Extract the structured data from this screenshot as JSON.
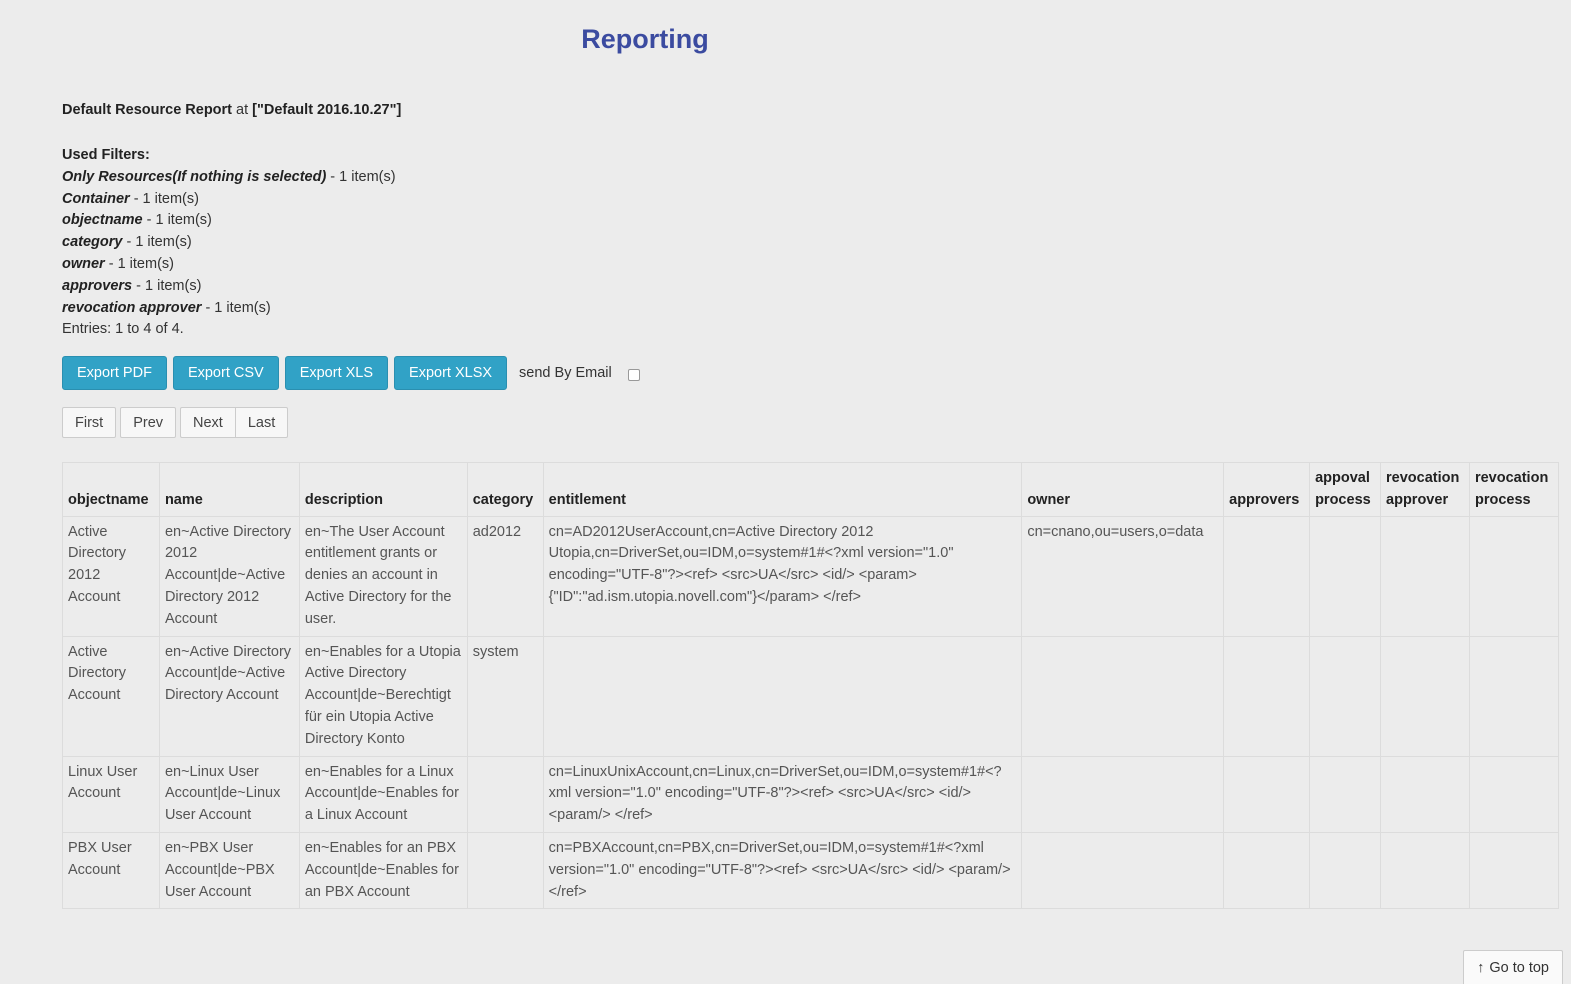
{
  "page": {
    "title": "Reporting"
  },
  "report": {
    "name": "Default Resource Report",
    "at_label": "at",
    "snapshot": "[\"Default 2016.10.27\"]"
  },
  "filters": {
    "title": "Used Filters:",
    "items": [
      {
        "name": "Only Resources(If nothing is selected)",
        "count": " - 1 item(s)"
      },
      {
        "name": "Container",
        "count": " - 1 item(s)"
      },
      {
        "name": "objectname",
        "count": " - 1 item(s)"
      },
      {
        "name": "category",
        "count": " - 1 item(s)"
      },
      {
        "name": "owner",
        "count": " - 1 item(s)"
      },
      {
        "name": "approvers",
        "count": " - 1 item(s)"
      },
      {
        "name": "revocation approver",
        "count": " - 1 item(s)"
      }
    ],
    "entries": "Entries: 1 to 4 of 4."
  },
  "export": {
    "pdf": "Export PDF",
    "csv": "Export CSV",
    "xls": "Export XLS",
    "xlsx": "Export XLSX",
    "email_label": "send By Email"
  },
  "pager": {
    "first": "First",
    "prev": "Prev",
    "next": "Next",
    "last": "Last"
  },
  "table": {
    "headers": [
      "objectname",
      "name",
      "description",
      "category",
      "entitlement",
      "owner",
      "approvers",
      "appoval process",
      "revocation approver",
      "revocation process"
    ],
    "rows": [
      [
        "Active Directory 2012 Account",
        "en~Active Directory 2012 Account|de~Active Directory 2012 Account",
        "en~The User Account entitlement grants or denies an account in Active Directory for the user.",
        "ad2012",
        "cn=AD2012UserAccount,cn=Active Directory 2012 Utopia,cn=DriverSet,ou=IDM,o=system#1#<?xml version=\"1.0\" encoding=\"UTF-8\"?><ref> <src>UA</src> <id/> <param>{\"ID\":\"ad.ism.utopia.novell.com\"}</param> </ref>",
        "cn=cnano,ou=users,o=data",
        "",
        "",
        "",
        ""
      ],
      [
        "Active Directory Account",
        "en~Active Directory Account|de~Active Directory Account",
        "en~Enables for a Utopia Active Directory Account|de~Berechtigt für ein Utopia Active Directory Konto",
        "system",
        "",
        "",
        "",
        "",
        "",
        ""
      ],
      [
        "Linux User Account",
        "en~Linux User Account|de~Linux User Account",
        "en~Enables for a Linux Account|de~Enables for a Linux Account",
        "",
        "cn=LinuxUnixAccount,cn=Linux,cn=DriverSet,ou=IDM,o=system#1#<?xml version=\"1.0\" encoding=\"UTF-8\"?><ref> <src>UA</src> <id/> <param/> </ref>",
        "",
        "",
        "",
        "",
        ""
      ],
      [
        "PBX User Account",
        "en~PBX User Account|de~PBX User Account",
        "en~Enables for an PBX Account|de~Enables for an PBX Account",
        "",
        "cn=PBXAccount,cn=PBX,cn=DriverSet,ou=IDM,o=system#1#<?xml version=\"1.0\" encoding=\"UTF-8\"?><ref> <src>UA</src> <id/> <param/> </ref>",
        "",
        "",
        "",
        "",
        ""
      ]
    ]
  },
  "footer": {
    "go_top": "Go to top",
    "go_top_icon": "arrow-up-icon"
  }
}
